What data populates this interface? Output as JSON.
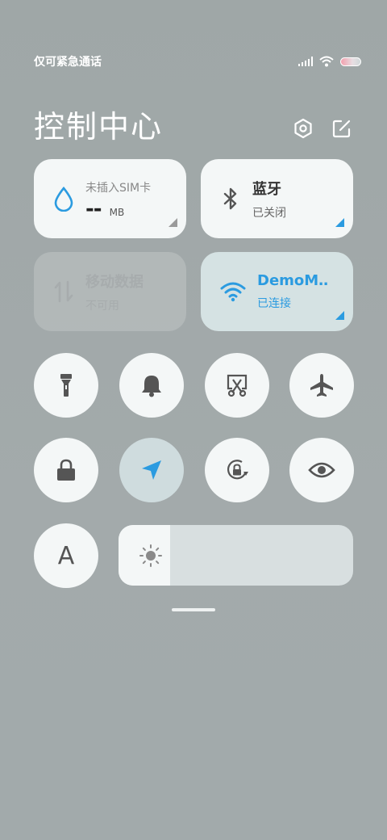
{
  "status_bar": {
    "carrier_text": "仅可紧急通话"
  },
  "header": {
    "title": "控制中心"
  },
  "tiles": {
    "sim": {
      "label": "未插入SIM卡",
      "value": "--",
      "unit": "MB"
    },
    "bluetooth": {
      "name": "蓝牙",
      "status": "已关闭"
    },
    "mobile_data": {
      "name": "移动数据",
      "status": "不可用"
    },
    "wifi": {
      "name": "DemoM‥",
      "status": "已连接"
    }
  },
  "toggles_row1": [
    "flashlight-icon",
    "bell-icon",
    "screenshot-icon",
    "airplane-icon"
  ],
  "toggles_row2": [
    "lock-icon",
    "location-icon",
    "rotation-lock-icon",
    "eye-icon"
  ],
  "font_toggle": {
    "label": "A"
  },
  "brightness": {
    "level": 0.22
  },
  "colors": {
    "accent": "#2b9be0",
    "icon": "#555555",
    "disabled": "#a7acad"
  }
}
